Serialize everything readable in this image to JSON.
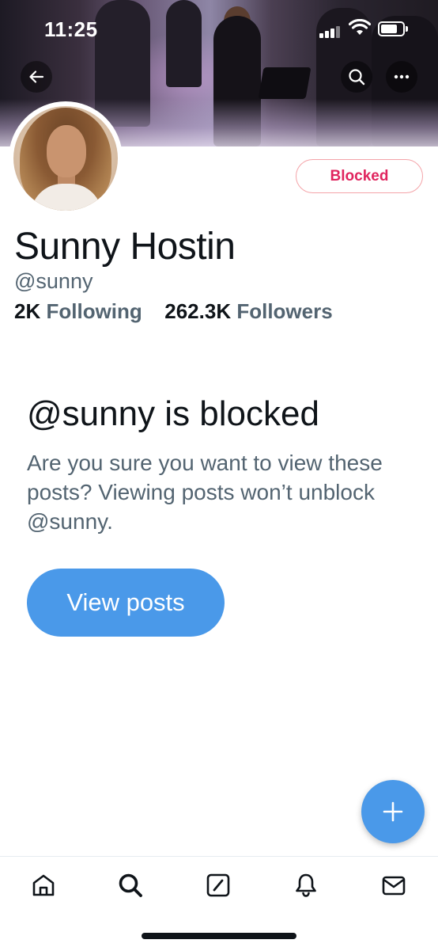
{
  "status_bar": {
    "time": "11:25"
  },
  "header": {
    "back_icon": "arrow-left-icon",
    "search_icon": "search-icon",
    "more_icon": "more-horizontal-icon"
  },
  "profile": {
    "display_name": "Sunny Hostin",
    "handle": "@sunny",
    "blocked_button_label": "Blocked",
    "following_count": "2K",
    "following_label": "Following",
    "followers_count": "262.3K",
    "followers_label": "Followers"
  },
  "blocked_notice": {
    "title": "@sunny is blocked",
    "body": "Are you sure you want to view these posts? Viewing posts won’t unblock @sunny.",
    "view_button_label": "View posts"
  },
  "fab": {
    "icon": "plus-icon"
  },
  "tab_bar": {
    "items": [
      {
        "icon": "home-icon"
      },
      {
        "icon": "search-icon"
      },
      {
        "icon": "compose-icon"
      },
      {
        "icon": "notifications-bell-icon"
      },
      {
        "icon": "messages-envelope-icon"
      }
    ]
  },
  "colors": {
    "accent": "#4a99e9",
    "blocked_text": "#e0245e",
    "blocked_border": "#f4a3a8",
    "secondary_text": "#536471",
    "primary_text": "#0f1419"
  }
}
